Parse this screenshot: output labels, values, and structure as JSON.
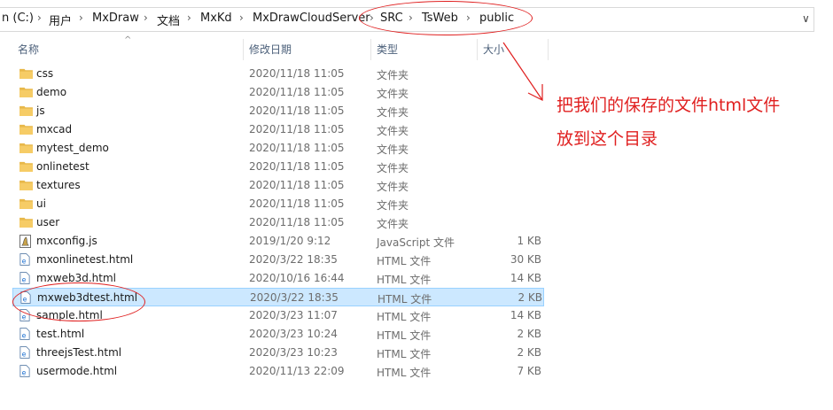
{
  "address_bar": {
    "crumbs": [
      "n (C:)",
      "用户",
      "MxDraw",
      "文档",
      "MxKd",
      "MxDrawCloudServer",
      "SRC",
      "TsWeb",
      "public"
    ]
  },
  "columns": {
    "name": "名称",
    "date": "修改日期",
    "type": "类型",
    "size": "大小"
  },
  "files": [
    {
      "name": "css",
      "date": "2020/11/18 11:05",
      "type": "文件夹",
      "size": "",
      "icon": "folder-icon"
    },
    {
      "name": "demo",
      "date": "2020/11/18 11:05",
      "type": "文件夹",
      "size": "",
      "icon": "folder-icon"
    },
    {
      "name": "js",
      "date": "2020/11/18 11:05",
      "type": "文件夹",
      "size": "",
      "icon": "folder-icon"
    },
    {
      "name": "mxcad",
      "date": "2020/11/18 11:05",
      "type": "文件夹",
      "size": "",
      "icon": "folder-icon"
    },
    {
      "name": "mytest_demo",
      "date": "2020/11/18 11:05",
      "type": "文件夹",
      "size": "",
      "icon": "folder-icon"
    },
    {
      "name": "onlinetest",
      "date": "2020/11/18 11:05",
      "type": "文件夹",
      "size": "",
      "icon": "folder-icon"
    },
    {
      "name": "textures",
      "date": "2020/11/18 11:05",
      "type": "文件夹",
      "size": "",
      "icon": "folder-icon"
    },
    {
      "name": "ui",
      "date": "2020/11/18 11:05",
      "type": "文件夹",
      "size": "",
      "icon": "folder-icon"
    },
    {
      "name": "user",
      "date": "2020/11/18 11:05",
      "type": "文件夹",
      "size": "",
      "icon": "folder-icon"
    },
    {
      "name": "mxconfig.js",
      "date": "2019/1/20 9:12",
      "type": "JavaScript 文件",
      "size": "1 KB",
      "icon": "js-file-icon"
    },
    {
      "name": "mxonlinetest.html",
      "date": "2020/3/22 18:35",
      "type": "HTML 文件",
      "size": "30 KB",
      "icon": "html-file-icon"
    },
    {
      "name": "mxweb3d.html",
      "date": "2020/10/16 16:44",
      "type": "HTML 文件",
      "size": "14 KB",
      "icon": "html-file-icon"
    },
    {
      "name": "mxweb3dtest.html",
      "date": "2020/3/22 18:35",
      "type": "HTML 文件",
      "size": "2 KB",
      "icon": "html-file-icon",
      "selected": true
    },
    {
      "name": "sample.html",
      "date": "2020/3/23 11:07",
      "type": "HTML 文件",
      "size": "14 KB",
      "icon": "html-file-icon"
    },
    {
      "name": "test.html",
      "date": "2020/3/23 10:24",
      "type": "HTML 文件",
      "size": "2 KB",
      "icon": "html-file-icon"
    },
    {
      "name": "threejsTest.html",
      "date": "2020/3/23 10:23",
      "type": "HTML 文件",
      "size": "2 KB",
      "icon": "html-file-icon"
    },
    {
      "name": "usermode.html",
      "date": "2020/11/13 22:09",
      "type": "HTML 文件",
      "size": "7 KB",
      "icon": "html-file-icon"
    }
  ],
  "annotation": {
    "line1": "把我们的保存的文件html文件",
    "line2": "放到这个目录",
    "color": "#e02020"
  },
  "colors": {
    "selection_bg": "#cce8ff",
    "folder": "#e8b84a",
    "header_text": "#4c607a"
  }
}
